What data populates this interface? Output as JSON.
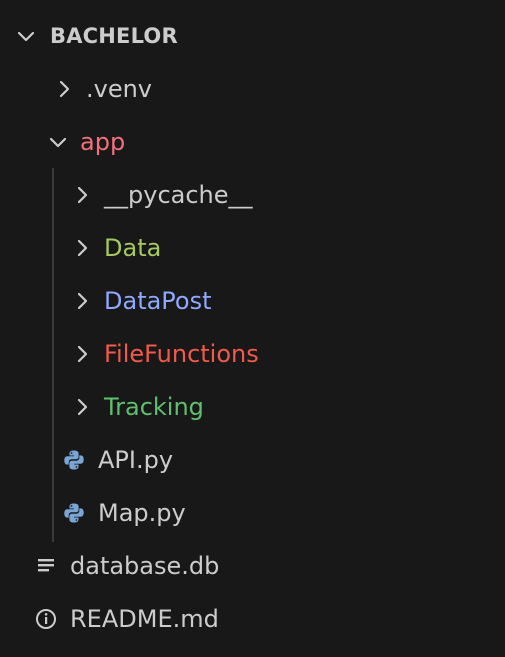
{
  "explorer": {
    "root": {
      "label": "BACHELOR",
      "expanded": true
    },
    "items": [
      {
        "label": ".venv",
        "type": "folder",
        "expanded": false,
        "color": "#cccccc"
      },
      {
        "label": "app",
        "type": "folder",
        "expanded": true,
        "color": "#f1707b"
      },
      {
        "label": "__pycache__",
        "type": "folder",
        "expanded": false,
        "color": "#cccccc"
      },
      {
        "label": "Data",
        "type": "folder",
        "expanded": false,
        "color": "#a5c861"
      },
      {
        "label": "DataPost",
        "type": "folder",
        "expanded": false,
        "color": "#8fa9ff"
      },
      {
        "label": "FileFunctions",
        "type": "folder",
        "expanded": false,
        "color": "#f15a4a"
      },
      {
        "label": "Tracking",
        "type": "folder",
        "expanded": false,
        "color": "#5fbf6e"
      },
      {
        "label": "API.py",
        "type": "file",
        "icon": "python-icon",
        "color": "#cccccc"
      },
      {
        "label": "Map.py",
        "type": "file",
        "icon": "python-icon",
        "color": "#cccccc"
      },
      {
        "label": "database.db",
        "type": "file",
        "icon": "database-lines-icon",
        "color": "#cccccc"
      },
      {
        "label": "README.md",
        "type": "file",
        "icon": "info-icon",
        "color": "#cccccc"
      }
    ]
  }
}
